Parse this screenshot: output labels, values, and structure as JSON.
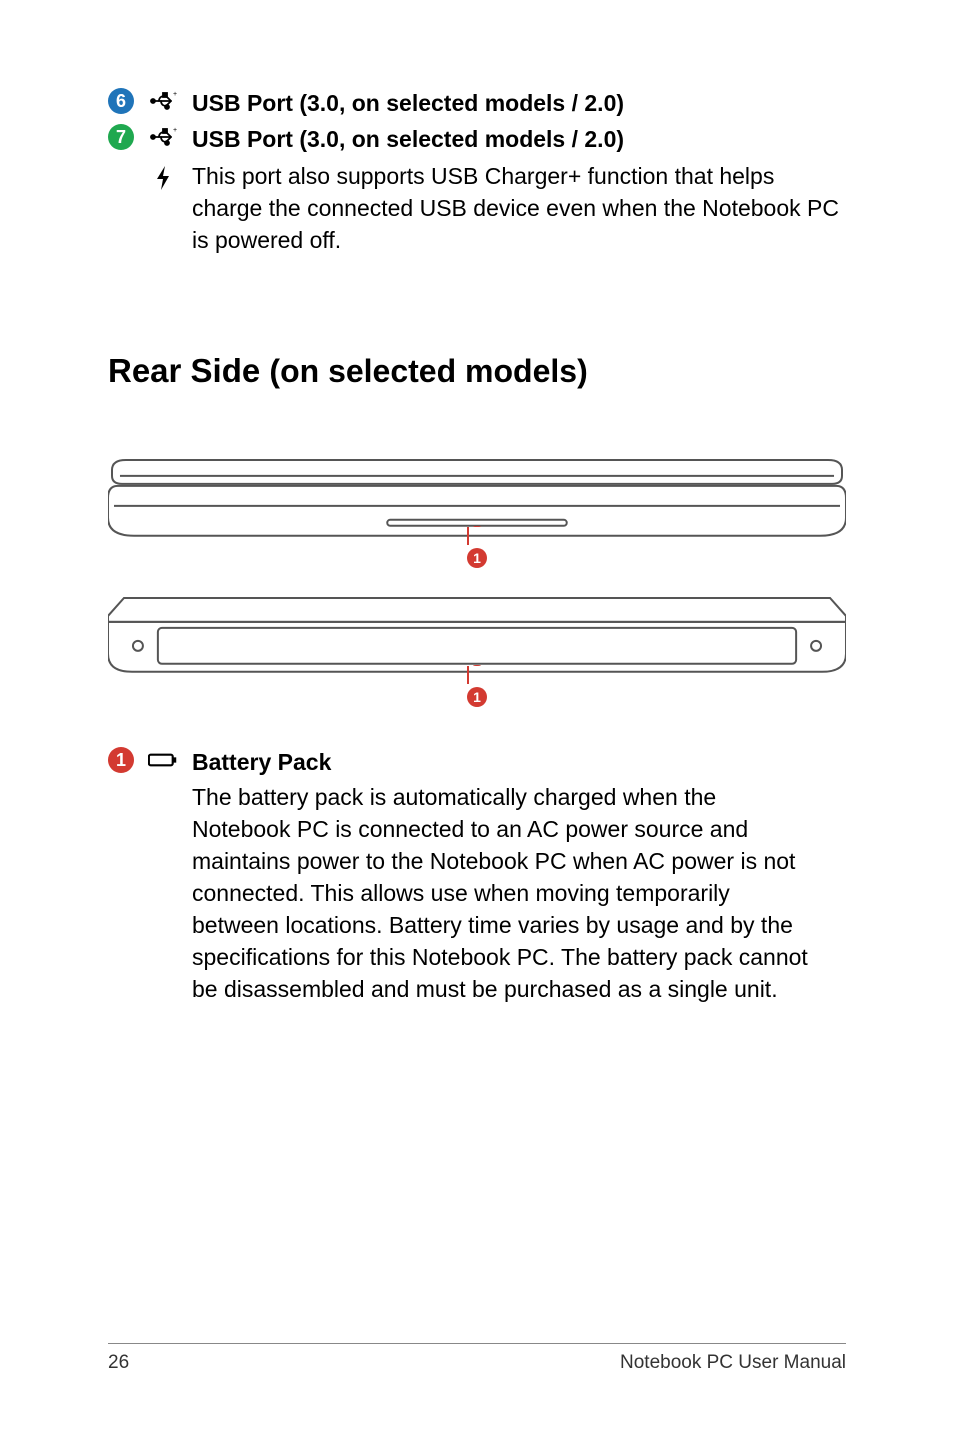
{
  "items": {
    "usb6": {
      "num": "6",
      "label": "USB Port (3.0, on selected models / 2.0)"
    },
    "usb7": {
      "num": "7",
      "label": "USB Port (3.0, on selected models / 2.0)",
      "sub": "This port also supports USB Charger+ function that helps charge the connected USB device even when the Notebook PC is powered off."
    },
    "battery": {
      "num": "1",
      "label": "Battery Pack",
      "desc": "The battery pack is automatically charged when the Notebook PC is connected to an AC power source and maintains power to the Notebook PC when AC power is not connected. This allows use when moving temporarily between locations. Battery time varies by usage and by the specifications for this Notebook PC. The battery pack cannot be disassembled and must be purchased as a single unit."
    }
  },
  "section": {
    "title": "Rear Side",
    "qualifier": "(on selected models)"
  },
  "diagram": {
    "callout": "1"
  },
  "footer": {
    "page": "26",
    "doc": "Notebook PC User Manual"
  }
}
